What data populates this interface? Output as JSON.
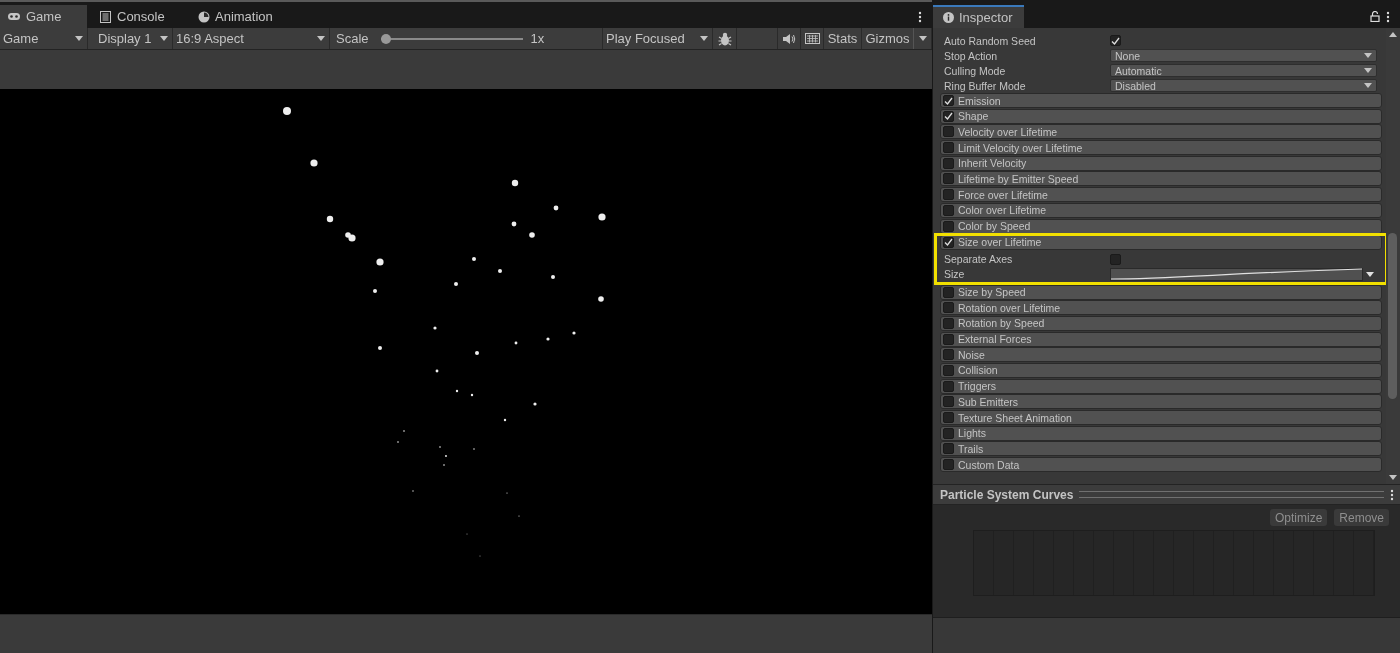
{
  "game_view": {
    "tabs": [
      {
        "label": "Game",
        "selected": true
      },
      {
        "label": "Console",
        "selected": false
      },
      {
        "label": "Animation",
        "selected": false
      }
    ],
    "toolbar": {
      "view_dropdown": "Game",
      "display_dropdown": "Display 1",
      "aspect_dropdown": "16:9 Aspect",
      "scale_label": "Scale",
      "scale_slider": {
        "level": 0
      },
      "scale_value": "1x",
      "play_mode_dropdown": "Play Focused",
      "stats_button": "Stats",
      "gizmos_button": "Gizmos"
    }
  },
  "inspector": {
    "tab": {
      "label": "Inspector",
      "selected": true
    },
    "properties": [
      {
        "kind": "checkbox",
        "label": "Auto Random Seed",
        "checked": true
      },
      {
        "kind": "dropdown",
        "label": "Stop Action",
        "value": "None"
      },
      {
        "kind": "dropdown",
        "label": "Culling Mode",
        "value": "Automatic"
      },
      {
        "kind": "dropdown",
        "label": "Ring Buffer Mode",
        "value": "Disabled"
      }
    ],
    "modules": [
      {
        "label": "Emission",
        "checked": true
      },
      {
        "label": "Shape",
        "checked": true
      },
      {
        "label": "Velocity over Lifetime",
        "checked": false
      },
      {
        "label": "Limit Velocity over Lifetime",
        "checked": false
      },
      {
        "label": "Inherit Velocity",
        "checked": false
      },
      {
        "label": "Lifetime by Emitter Speed",
        "checked": false
      },
      {
        "label": "Force over Lifetime",
        "checked": false
      },
      {
        "label": "Color over Lifetime",
        "checked": false
      },
      {
        "label": "Color by Speed",
        "checked": false
      },
      {
        "label": "Size over Lifetime",
        "checked": true,
        "highlighted": true,
        "expanded": true,
        "properties": [
          {
            "kind": "checkbox",
            "label": "Separate Axes",
            "checked": false
          },
          {
            "kind": "curve",
            "label": "Size"
          }
        ]
      },
      {
        "label": "Size by Speed",
        "checked": false
      },
      {
        "label": "Rotation over Lifetime",
        "checked": false
      },
      {
        "label": "Rotation by Speed",
        "checked": false
      },
      {
        "label": "External Forces",
        "checked": false
      },
      {
        "label": "Noise",
        "checked": false
      },
      {
        "label": "Collision",
        "checked": false
      },
      {
        "label": "Triggers",
        "checked": false
      },
      {
        "label": "Sub Emitters",
        "checked": false
      },
      {
        "label": "Texture Sheet Animation",
        "checked": false
      },
      {
        "label": "Lights",
        "checked": false
      },
      {
        "label": "Trails",
        "checked": false
      },
      {
        "label": "Custom Data",
        "checked": false
      }
    ]
  },
  "curves_panel": {
    "title": "Particle System Curves",
    "buttons": [
      "Optimize",
      "Remove"
    ]
  }
}
